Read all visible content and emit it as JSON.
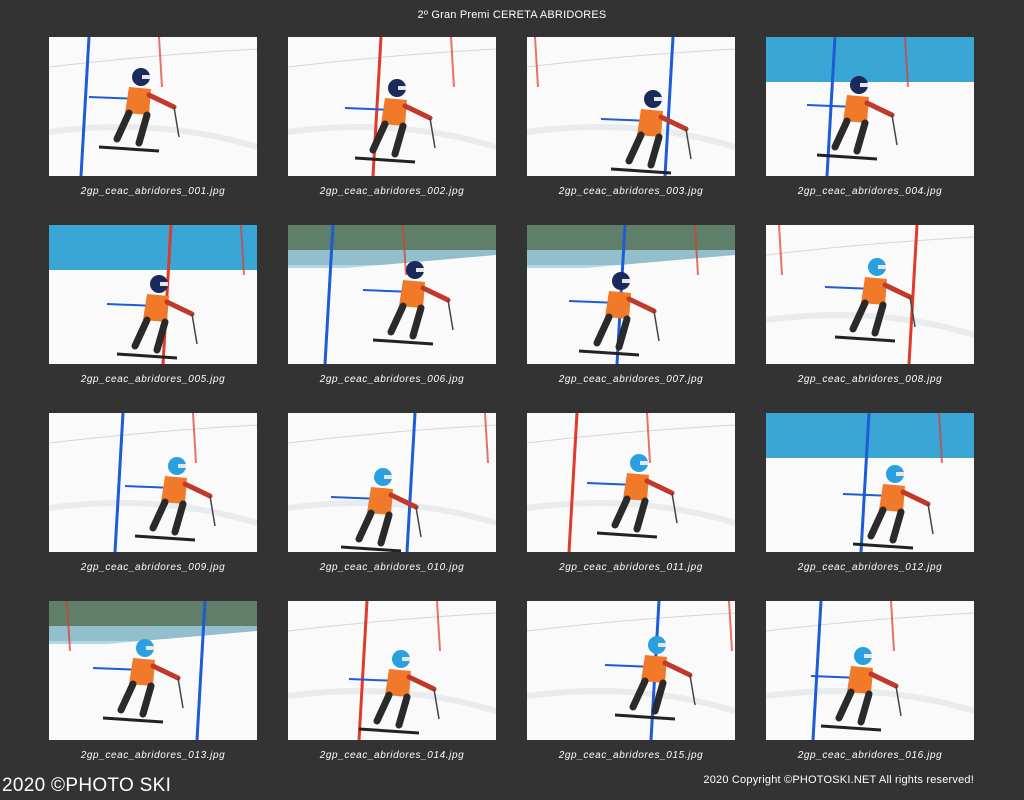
{
  "header": {
    "title": "2º Gran Premi CERETA ABRIDORES"
  },
  "gallery": {
    "items": [
      {
        "filename": "2gp_ceac_abridores_001.jpg",
        "scene": "slope",
        "helmet": "navy"
      },
      {
        "filename": "2gp_ceac_abridores_002.jpg",
        "scene": "slope",
        "helmet": "navy"
      },
      {
        "filename": "2gp_ceac_abridores_003.jpg",
        "scene": "slope",
        "helmet": "navy"
      },
      {
        "filename": "2gp_ceac_abridores_004.jpg",
        "scene": "fence",
        "helmet": "navy"
      },
      {
        "filename": "2gp_ceac_abridores_005.jpg",
        "scene": "fence",
        "helmet": "navy"
      },
      {
        "filename": "2gp_ceac_abridores_006.jpg",
        "scene": "forest",
        "helmet": "navy"
      },
      {
        "filename": "2gp_ceac_abridores_007.jpg",
        "scene": "forest",
        "helmet": "navy"
      },
      {
        "filename": "2gp_ceac_abridores_008.jpg",
        "scene": "slope",
        "helmet": "cyan"
      },
      {
        "filename": "2gp_ceac_abridores_009.jpg",
        "scene": "slope",
        "helmet": "cyan"
      },
      {
        "filename": "2gp_ceac_abridores_010.jpg",
        "scene": "slope",
        "helmet": "cyan"
      },
      {
        "filename": "2gp_ceac_abridores_011.jpg",
        "scene": "slope",
        "helmet": "cyan"
      },
      {
        "filename": "2gp_ceac_abridores_012.jpg",
        "scene": "fence",
        "helmet": "cyan"
      },
      {
        "filename": "2gp_ceac_abridores_013.jpg",
        "scene": "forest",
        "helmet": "cyan"
      },
      {
        "filename": "2gp_ceac_abridores_014.jpg",
        "scene": "slope",
        "helmet": "cyan"
      },
      {
        "filename": "2gp_ceac_abridores_015.jpg",
        "scene": "slope",
        "helmet": "cyan"
      },
      {
        "filename": "2gp_ceac_abridores_016.jpg",
        "scene": "slope",
        "helmet": "cyan"
      }
    ]
  },
  "footer": {
    "watermark": "2020 ©PHOTO SKI",
    "copyright": "2020 Copyright ©PHOTOSKI.NET All rights reserved!"
  },
  "colors": {
    "background": "#333333",
    "snow": "#fafafa",
    "fence": "#3aa6d6",
    "pole_blue": "#1e5bd6",
    "pole_red": "#e03a2a",
    "bib_orange": "#f07a2a",
    "helmet_navy": "#1a2a5a",
    "helmet_cyan": "#2aa0e0"
  }
}
